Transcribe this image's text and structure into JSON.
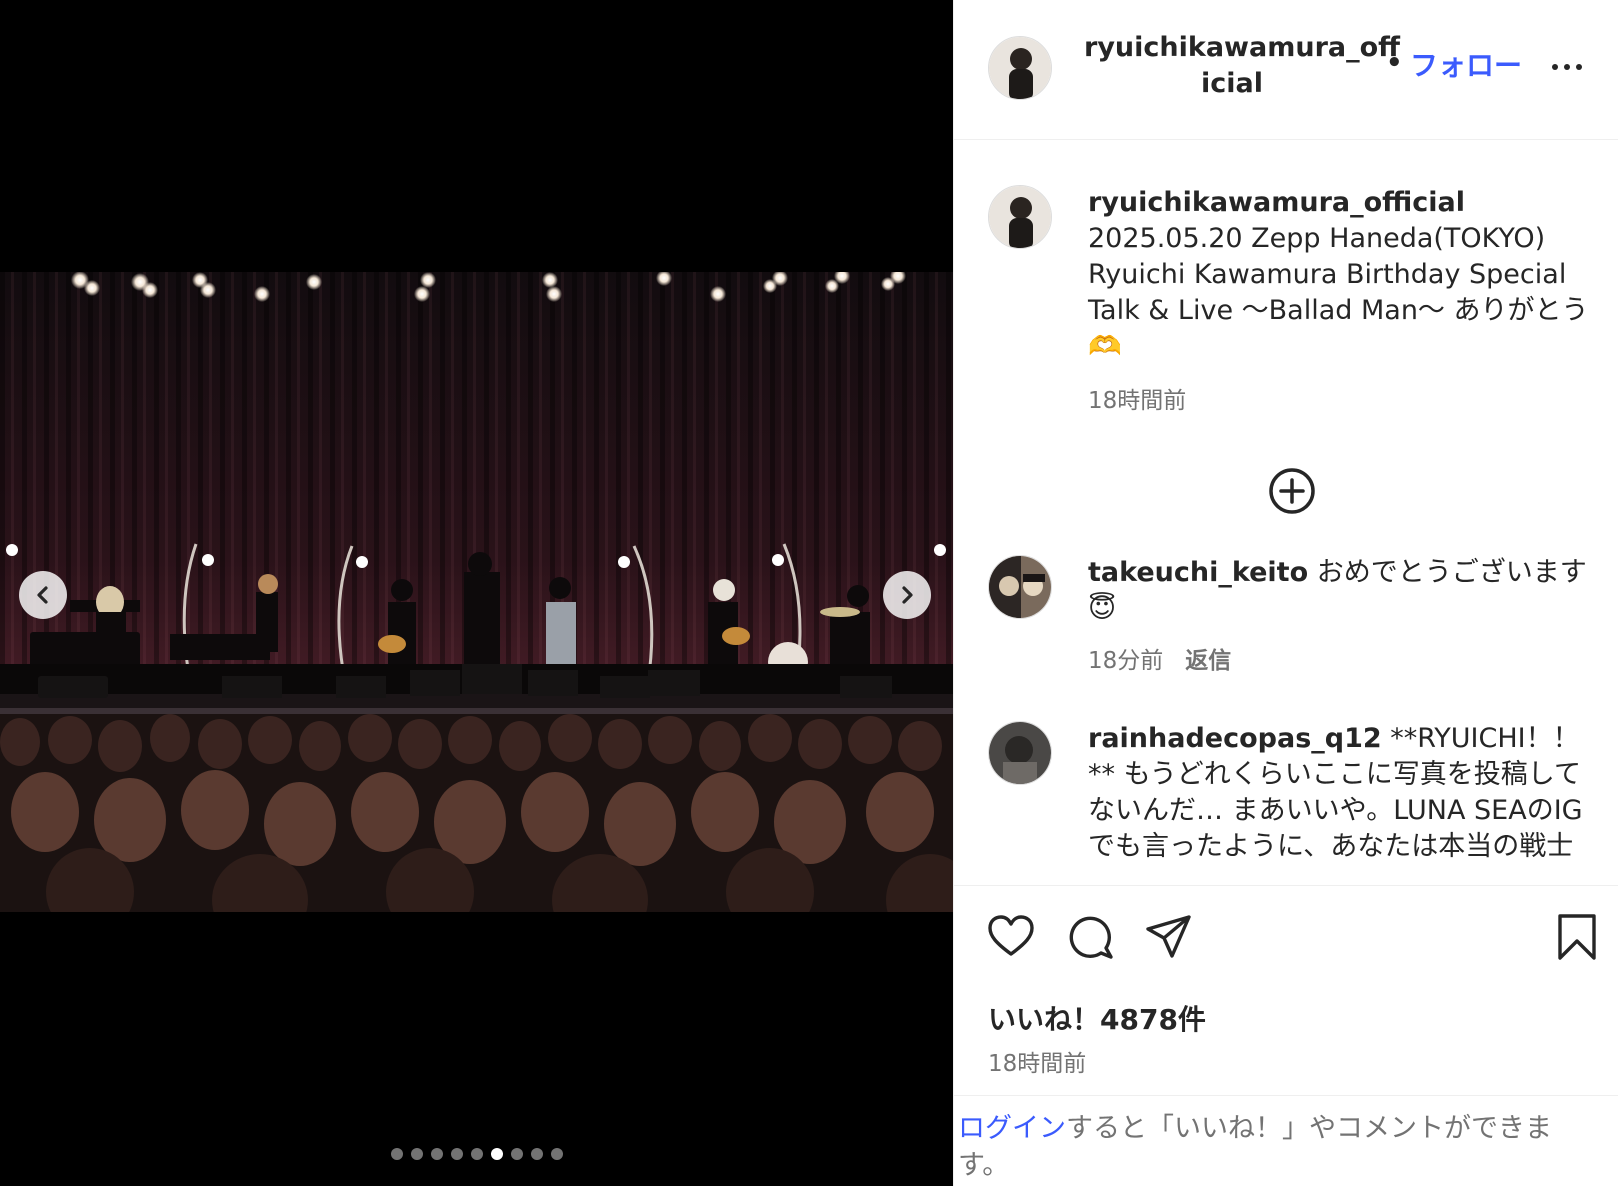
{
  "post": {
    "username": "ryuichikawamura_official",
    "username_display": "ryuichikawamura_off icial",
    "separator": "•",
    "follow_label": "フォロー",
    "caption": "2025.05.20 Zepp Haneda(TOKYO) Ryuichi Kawamura Birthday Special Talk & Live 〜Ballad Man〜 ありがとう🫶",
    "caption_time": "18時間前",
    "likes": "いいね！4878件",
    "time": "18時間前"
  },
  "carousel": {
    "total": 9,
    "active_index": 5
  },
  "comments": [
    {
      "username": "takeuchi_keito",
      "text": "おめでとうございます😇",
      "time": "18分前",
      "reply_label": "返信"
    },
    {
      "username": "rainhadecopas_q12",
      "text": "**RYUICHI！！** もうどれくらいここに写真を投稿してないんだ… まあいいや。LUNA SEAのIGでも言ったように、あなたは本当の戦士"
    }
  ],
  "login_bar": {
    "link": "ログイン",
    "text": "すると「いいね！」やコメントができます。"
  },
  "icons": [
    "chevron-left-icon",
    "chevron-right-icon",
    "more-icon",
    "add-circle-icon",
    "heart-icon",
    "comment-icon",
    "share-icon",
    "bookmark-icon"
  ],
  "colors": {
    "accent": "#3b5bfd",
    "secondary_text": "#737373",
    "media_background": "#000000"
  }
}
